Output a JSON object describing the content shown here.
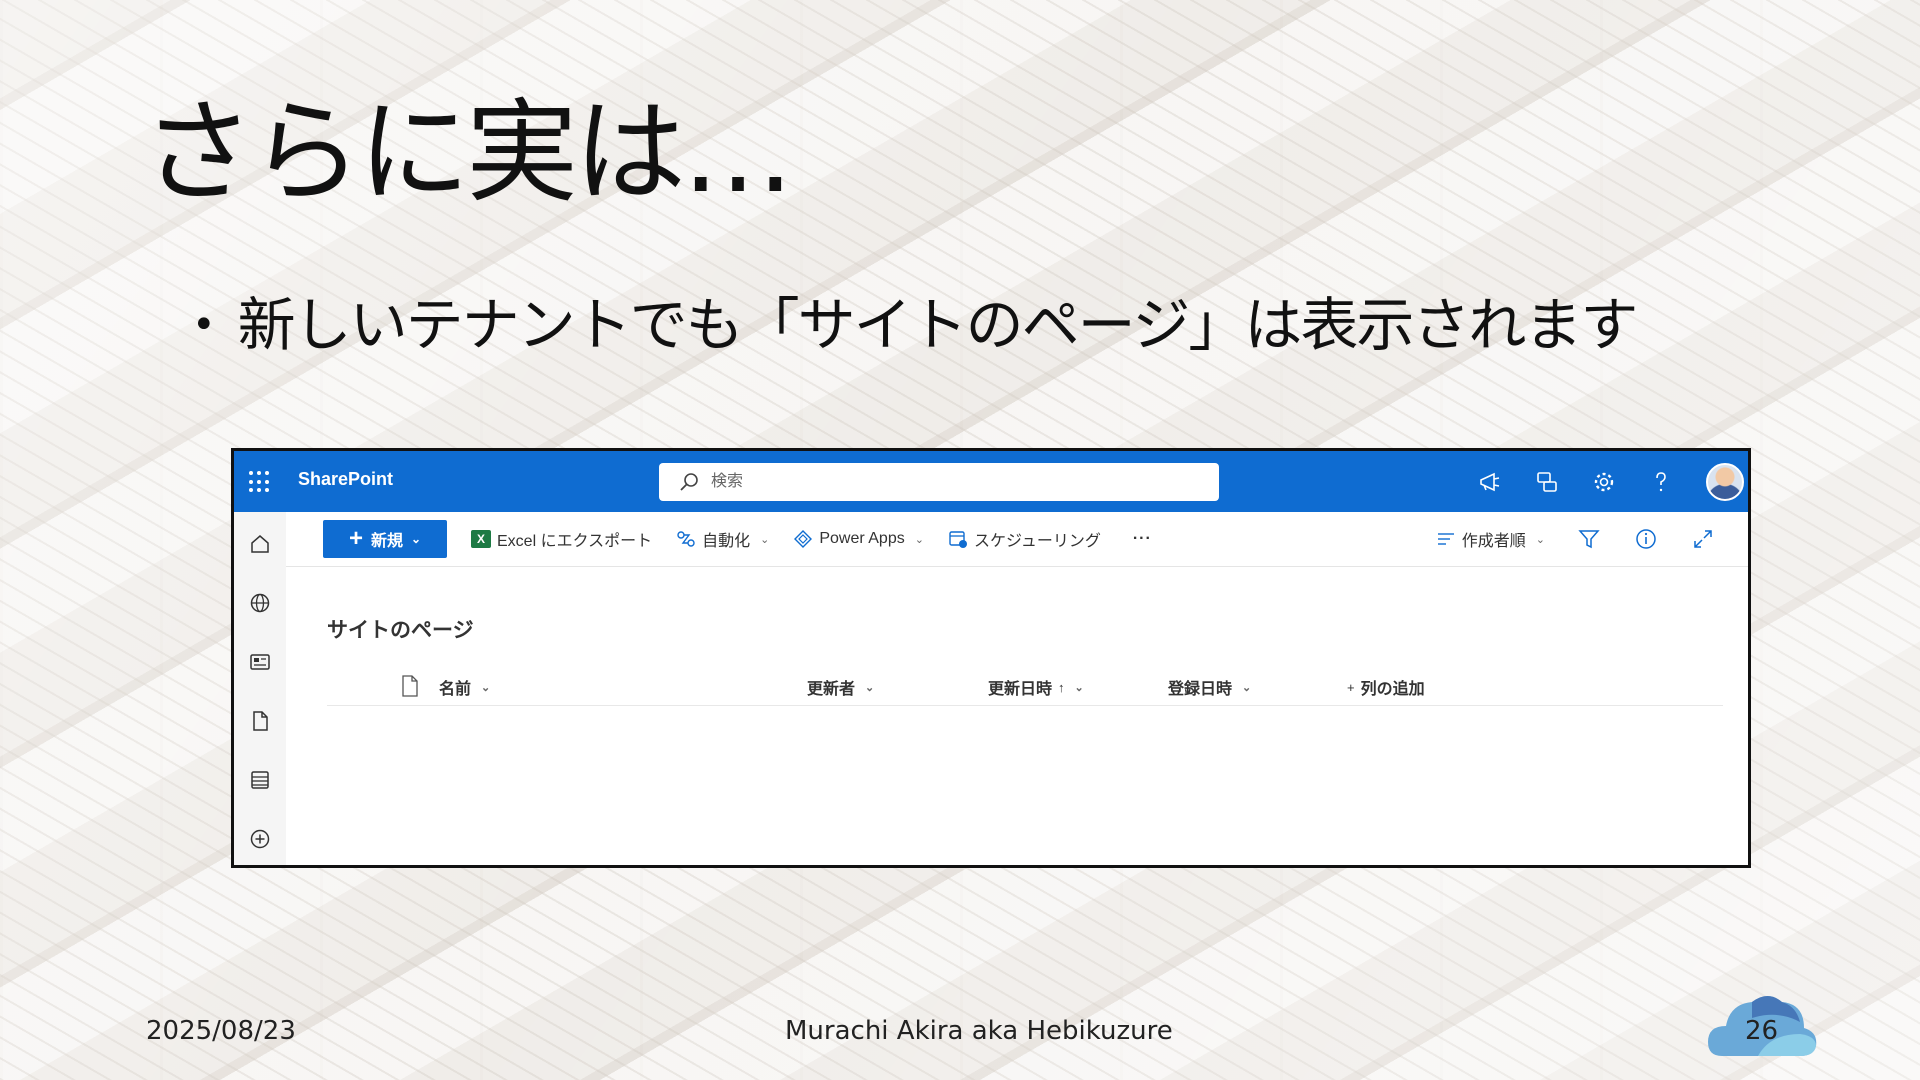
{
  "slide": {
    "title": "さらに実は…",
    "bullet": "新しいテナントでも「サイトのページ」は表示されます",
    "footer_date": "2025/08/23",
    "footer_author": "Murachi Akira aka Hebikuzure",
    "page_number": "26"
  },
  "sharepoint": {
    "brand": "SharePoint",
    "search_placeholder": "検索",
    "accent_color": "#0f6cd1",
    "header_icons": [
      "megaphone-icon",
      "chat-icon",
      "gear-icon",
      "help-icon",
      "avatar"
    ],
    "left_rail_icons": [
      "home-icon",
      "globe-icon",
      "news-icon",
      "file-icon",
      "list-icon",
      "add-icon"
    ],
    "commands": {
      "new_label": "新規",
      "export_label": "Excel にエクスポート",
      "automate_label": "自動化",
      "power_apps_label": "Power Apps",
      "schedule_label": "スケジューリング",
      "more_label": "···",
      "sort_label": "作成者順"
    },
    "list": {
      "title": "サイトのページ",
      "columns": {
        "name": "名前",
        "modified_by": "更新者",
        "modified": "更新日時",
        "modified_sort": "↑",
        "created": "登録日時",
        "add_column": "列の追加"
      }
    }
  }
}
